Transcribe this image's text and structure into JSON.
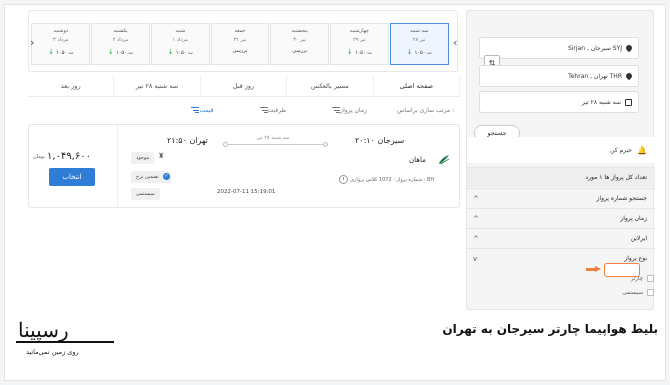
{
  "date_strip": {
    "days": [
      {
        "name": "سه شنبه",
        "date": "۲۸ تیر",
        "price": "۱۰۵۰ ت",
        "low": true,
        "active": true
      },
      {
        "name": "چهارشنبه",
        "date": "۲۹ تیر",
        "price": "۱۰۵۰ ت",
        "low": true,
        "active": false
      },
      {
        "name": "پنجشنبه",
        "date": "۳۰ تیر",
        "price": "بررسی",
        "low": false,
        "active": false
      },
      {
        "name": "جمعه",
        "date": "۳۱ تیر",
        "price": "بررسی",
        "low": false,
        "active": false
      },
      {
        "name": "شنبه",
        "date": "۱ مرداد",
        "price": "۱۰۵۰ ت",
        "low": true,
        "active": false
      },
      {
        "name": "یکشنبه",
        "date": "۲ مرداد",
        "price": "۱۰۵۰ ت",
        "low": true,
        "active": false
      },
      {
        "name": "دوشنبه",
        "date": "۳ مرداد",
        "price": "۱۰۵۰ ت",
        "low": true,
        "active": false
      }
    ],
    "prev_icon": "‹",
    "next_icon": "›"
  },
  "tabs": [
    "صفحه اصلی",
    "مسیر بالعکس",
    "روز قبل",
    "سه شنبه ۲۸ تیر",
    "روز بعد"
  ],
  "sort": {
    "label": "مرتب سازی براساس :",
    "options": [
      "زمان پرواز",
      "ظرفیت",
      "قیمت"
    ]
  },
  "flight": {
    "dep_city": "سیرجان",
    "dep_time": "۲۰:۱۰",
    "arr_city": "تهران",
    "arr_time": "۲۱:۵۰",
    "date": "سه شنبه ۲۸ تیر",
    "airline": "ماهان",
    "meta": "شماره پرواز : 1072   کلاس پروازی : BH",
    "price": "۱,۰۴۹,۶۰۰",
    "price_unit": "تومان",
    "select_label": "انتخاب",
    "badge_available": "موجود",
    "badge_guarantee": "تضمین نرخ",
    "badge_type": "سیستمی",
    "timestamp": "2022-07-11 15:19:01"
  },
  "sidebar": {
    "origin": "Sirjan , سیرجان SYJ",
    "destination": "Tehran , تهران THR",
    "date": "سه شنبه ۲۸ تیر",
    "swap_icon": "⇅",
    "search_label": "جستجو",
    "notify_label": "خبرم کن",
    "filters": [
      {
        "label": "تعداد کل پرواز ها ۱ مورد",
        "chevron": ""
      },
      {
        "label": "جستجو شماره پرواز",
        "chevron": "^"
      },
      {
        "label": "زمان پرواز",
        "chevron": "^"
      },
      {
        "label": "ایرلاین",
        "chevron": "^"
      },
      {
        "label": "نوع پرواز",
        "chevron": "v"
      }
    ],
    "type_options": [
      "چارتر",
      "سیستمی"
    ]
  },
  "caption": "بلیط هواپیما چارتر سیرجان به تهران",
  "brand": {
    "name": "رسپینا",
    "tagline": "روی زمین نمی‌مانید"
  },
  "colors": {
    "accent": "#2f7dd6",
    "highlight": "#f07f3c",
    "low_price": "#27a844"
  }
}
